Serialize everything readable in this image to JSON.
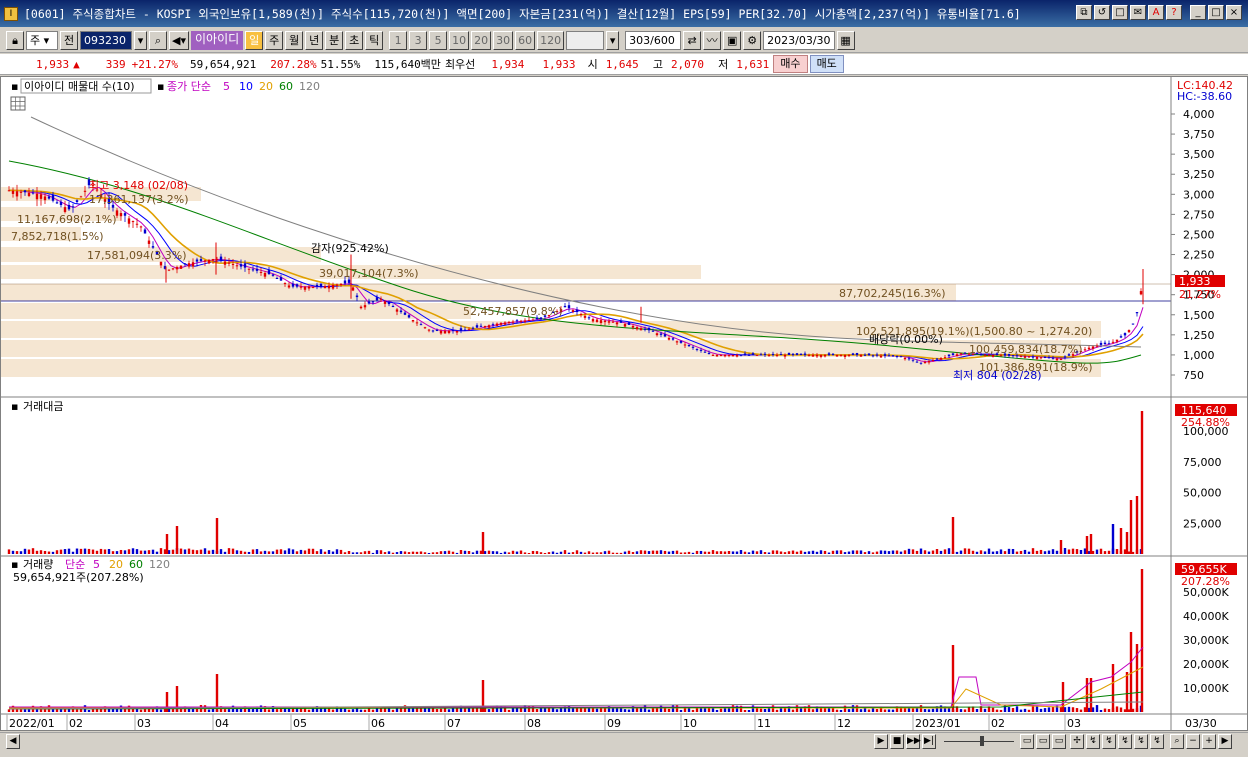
{
  "window": {
    "title": "[0601] 주식종합차트 - KOSPI 외국인보유[1,589(천)] 주식수[115,720(천)] 액면[200] 자본금[231(억)] 결산[12월] EPS[59] PER[32.70] 시가총액[2,237(억)] 유통비율[71.6]",
    "buttons": [
      "⧉",
      "↺",
      "□",
      "✉",
      "A",
      "?",
      "_",
      "□",
      "×"
    ]
  },
  "toolbar": {
    "period_select": "주",
    "prev_label": "전",
    "stock_code": "093230",
    "stock_name": "이아이디",
    "period_buttons": [
      "일",
      "주",
      "월",
      "년",
      "분",
      "초",
      "틱"
    ],
    "interval_buttons": [
      "1",
      "3",
      "5",
      "10",
      "20",
      "30",
      "60",
      "120"
    ],
    "count": "303",
    "count_total": "/600",
    "date": "2023/03/30"
  },
  "quote": {
    "price": "1,933",
    "arrow": "▲",
    "change": "339",
    "change_pct": "+21.27%",
    "volume": "59,654,921",
    "volume_pct": "207.28%",
    "turnover_pct": "51.55%",
    "amount": "115,640백만",
    "best_label": "최우선",
    "ask": "1,934",
    "bid": "1,933",
    "open_label": "시",
    "open": "1,645",
    "high_label": "고",
    "high": "2,070",
    "low_label": "저",
    "low": "1,631",
    "buy": "매수",
    "sell": "매도"
  },
  "price_pane": {
    "legend_name": "이아이디 매물대 수(10)",
    "legend_ma": "종가 단순",
    "ma_periods": [
      "5",
      "10",
      "20",
      "60",
      "120"
    ],
    "ma_colors": [
      "#c000c0",
      "#0000ff",
      "#e0a000",
      "#008000",
      "#808080"
    ],
    "lc": "LC:140.42",
    "hc": "HC:-38.60",
    "y_ticks": [
      "4,000",
      "3,750",
      "3,500",
      "3,250",
      "3,000",
      "2,750",
      "2,500",
      "2,250",
      "2,000",
      "1,750",
      "1,500",
      "1,250",
      "1,000",
      "750"
    ],
    "last_price": "1,933",
    "last_pct": "21.27%",
    "annotations": {
      "high": "최고 3,148 (02/08)",
      "low": "최저 804 (02/28)",
      "capital_reduction": "감자(925.42%)",
      "allotment": "배당락(0.00%)",
      "vp1": "17,361,137(3.2%)",
      "vp2": "11,167,698(2.1%)",
      "vp3": "7,852,718(1.5%)",
      "vp4": "17,581,094(3.3%)",
      "vp5": "39,017,104(7.3%)",
      "vp6": "87,702,245(16.3%)",
      "vp7": "52,457,857(9.8%)",
      "vp8": "102,521,895(19.1%)(1,500.80 ~ 1,274.20)",
      "vp9": "100,459,834(18.7%)",
      "vp10": "101,386,891(18.9%)"
    }
  },
  "amount_pane": {
    "legend": "거래대금",
    "y_ticks": [
      "100,000",
      "75,000",
      "50,000",
      "25,000"
    ],
    "last_value": "115,640",
    "last_pct": "254.88%"
  },
  "volume_pane": {
    "legend": "거래량",
    "legend_ma": "단순",
    "ma_periods": [
      "5",
      "20",
      "60",
      "120"
    ],
    "ma_colors": [
      "#c000c0",
      "#e0a000",
      "#008000",
      "#808080"
    ],
    "value_label": "59,654,921주(207.28%)",
    "y_ticks": [
      "50,000K",
      "40,000K",
      "30,000K",
      "20,000K",
      "10,000K"
    ],
    "last_value": "59,655K",
    "last_pct": "207.28%"
  },
  "x_axis": {
    "labels": [
      "2022/01",
      "02",
      "03",
      "04",
      "05",
      "06",
      "07",
      "08",
      "09",
      "10",
      "11",
      "12",
      "2023/01",
      "02",
      "03"
    ],
    "cursor_date": "03/30"
  }
}
